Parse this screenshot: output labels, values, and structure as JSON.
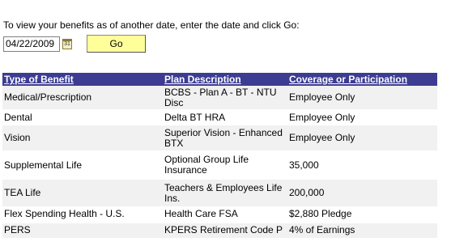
{
  "instructions": "To view your benefits as of another date, enter the date and click Go:",
  "date_field": {
    "value": "04/22/2009"
  },
  "calendar_icon": {
    "glyph": "31"
  },
  "go_button": {
    "label": "Go"
  },
  "colors": {
    "header_bg": "#3c3c92",
    "go_button_bg": "#ffff99",
    "row_alt_bg": "#f1f1f1"
  },
  "table": {
    "headers": [
      "Type of Benefit",
      "Plan Description",
      "Coverage or Participation"
    ],
    "rows": [
      [
        "Medical/Prescription",
        "BCBS - Plan A - BT - NTU Disc",
        "Employee Only"
      ],
      [
        "Dental",
        "Delta BT HRA",
        "Employee Only"
      ],
      [
        "Vision",
        "Superior Vision - Enhanced BTX",
        "Employee Only"
      ],
      [
        "Supplemental Life",
        "Optional Group Life Insurance",
        "35,000"
      ],
      [
        "TEA Life",
        "Teachers & Employees Life Ins.",
        "200,000"
      ],
      [
        "Flex Spending Health - U.S.",
        "Health Care FSA",
        "$2,880 Pledge"
      ],
      [
        "PERS",
        "KPERS Retirement Code P",
        "4% of Earnings"
      ]
    ]
  }
}
